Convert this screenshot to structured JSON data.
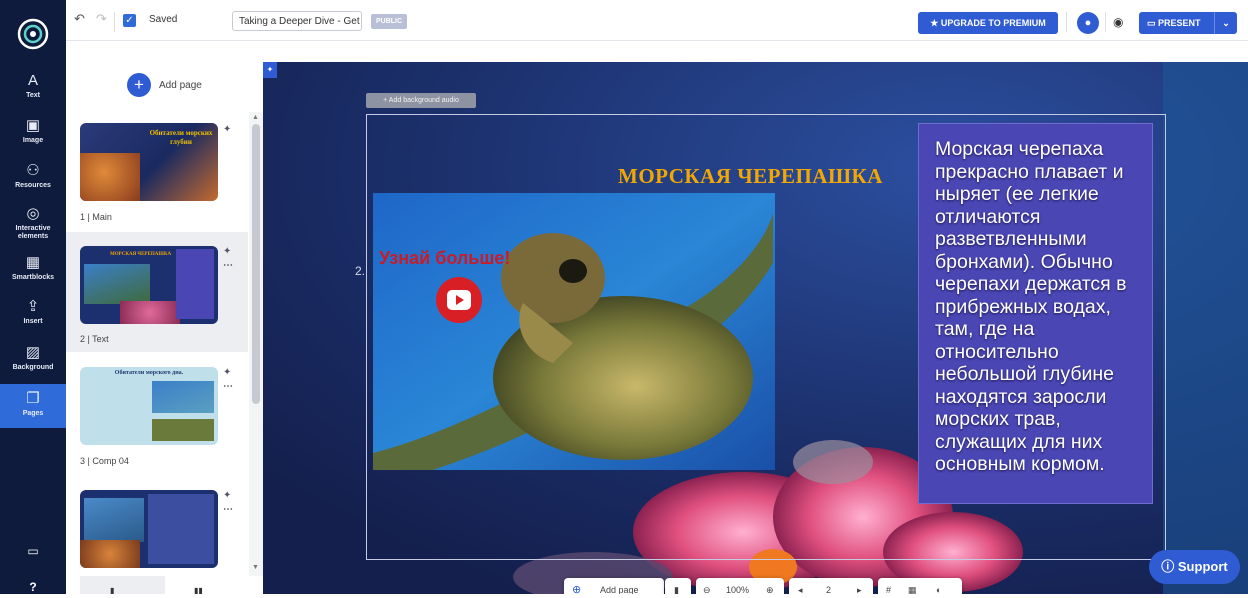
{
  "rail": {
    "tools": [
      {
        "name": "text",
        "label": "Text",
        "glyph": "A"
      },
      {
        "name": "image",
        "label": "Image",
        "glyph": "▣"
      },
      {
        "name": "resources",
        "label": "Resources",
        "glyph": "⚇"
      },
      {
        "name": "interactive",
        "label": "Interactive elements",
        "glyph": "◎"
      },
      {
        "name": "smartblocks",
        "label": "Smartblocks",
        "glyph": "▦"
      },
      {
        "name": "insert",
        "label": "Insert",
        "glyph": "⇪"
      },
      {
        "name": "background",
        "label": "Background",
        "glyph": "▨"
      },
      {
        "name": "pages",
        "label": "Pages",
        "glyph": "❐"
      }
    ],
    "bottom_glyphs": {
      "briefcase": "▭",
      "help": "?"
    }
  },
  "topbar": {
    "undo_glyph": "↶",
    "redo_glyph": "↷",
    "saved_label": "Saved",
    "title_value": "Taking a Deeper Dive - Get",
    "public_badge": "PUBLIC",
    "upgrade_label": "UPGRADE TO PREMIUM",
    "present_label": "PRESENT",
    "eye_glyph": "◉",
    "avatar_glyph": "●",
    "dropdown_glyph": "⌄"
  },
  "pages_panel": {
    "add_page_label": "Add page",
    "pages": [
      {
        "label": "1 | Main",
        "thumb_title": "Обитатели морских глубин"
      },
      {
        "label": "2 | Text",
        "thumb_title": "МОРСКАЯ ЧЕРЕПАШКА"
      },
      {
        "label": "3 | Comp 04",
        "thumb_title": "Обитатели морского дна."
      },
      {
        "label": "",
        "thumb_title": ""
      }
    ]
  },
  "canvas": {
    "bg_audio_label": "Add background audio",
    "slide_number": "2.",
    "slide_title": "МОРСКАЯ ЧЕРЕПАШКА",
    "youtube_label": "Узнай больше!",
    "body_text": "Морская черепаха прекрасно плавает и ныряет (ее легкие отличаются разветвленными бронхами). Обычно черепахи держатся в прибрежных водах, там, где на относительно небольшой глубине находятся заросли морских трав, служащих для них основным кормом.",
    "support_label": "Support"
  },
  "bottom_toolbar": {
    "add_page_label": "Add page",
    "zoom_label": "100%",
    "page_number": "2"
  },
  "colors": {
    "rail_bg": "#0e1b3d",
    "accent": "#2f5bd3",
    "title_gold": "#f2a800",
    "youtube_red": "#d81f26"
  }
}
